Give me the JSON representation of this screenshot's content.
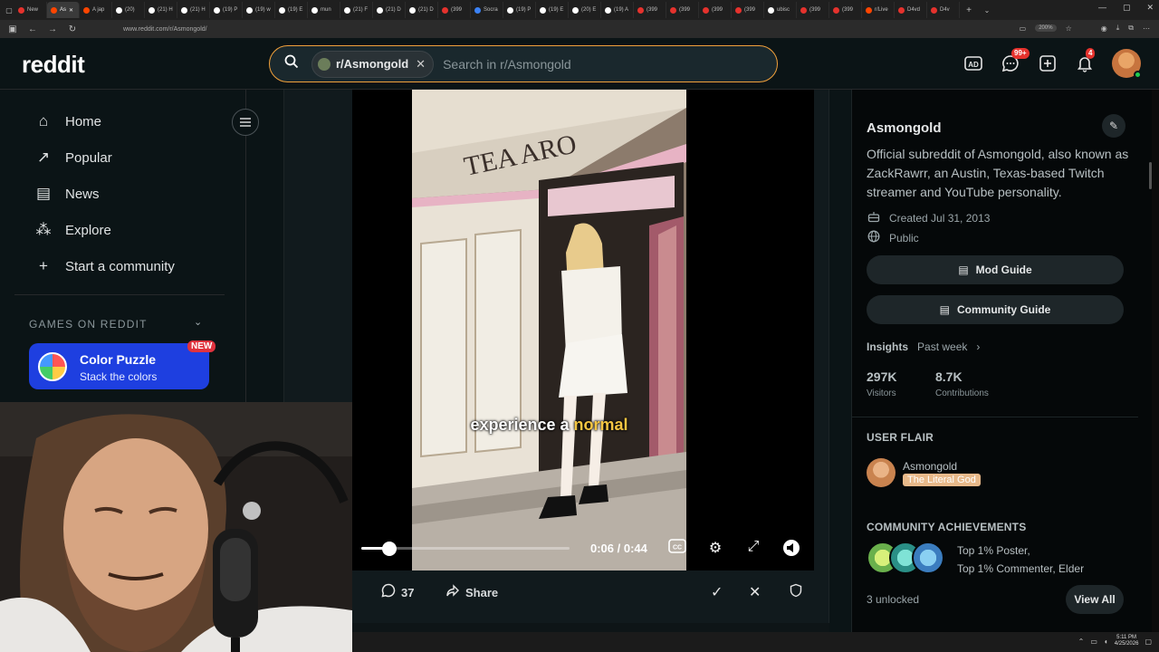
{
  "browser": {
    "tabs": [
      {
        "label": "New",
        "color": "#e5322d"
      },
      {
        "label": "As",
        "color": "#ff4500",
        "active": true
      },
      {
        "label": "A jap",
        "color": "#ff4500"
      },
      {
        "label": "(20)",
        "color": "#ffffff"
      },
      {
        "label": "(21) H",
        "color": "#ffffff"
      },
      {
        "label": "(21) H",
        "color": "#ffffff"
      },
      {
        "label": "(19) P",
        "color": "#ffffff"
      },
      {
        "label": "(19) w",
        "color": "#ffffff"
      },
      {
        "label": "(19) E",
        "color": "#ffffff"
      },
      {
        "label": "mun",
        "color": "#ffffff"
      },
      {
        "label": "(21) F",
        "color": "#ffffff"
      },
      {
        "label": "(21) D",
        "color": "#ffffff"
      },
      {
        "label": "(21) D",
        "color": "#ffffff"
      },
      {
        "label": "(399",
        "color": "#e5322d"
      },
      {
        "label": "Socra",
        "color": "#3b82f6"
      },
      {
        "label": "(19) P",
        "color": "#ffffff"
      },
      {
        "label": "(19) E",
        "color": "#ffffff"
      },
      {
        "label": "(20) E",
        "color": "#ffffff"
      },
      {
        "label": "(19) A",
        "color": "#ffffff"
      },
      {
        "label": "(399",
        "color": "#e5322d"
      },
      {
        "label": "(399",
        "color": "#e5322d"
      },
      {
        "label": "(399",
        "color": "#e5322d"
      },
      {
        "label": "(399",
        "color": "#e5322d"
      },
      {
        "label": "ubisc",
        "color": "#ffffff"
      },
      {
        "label": "(399",
        "color": "#e5322d"
      },
      {
        "label": "(399",
        "color": "#e5322d"
      },
      {
        "label": "r/Live",
        "color": "#ff4500"
      },
      {
        "label": "D4vd",
        "color": "#e5322d"
      },
      {
        "label": "D4v",
        "color": "#e5322d"
      }
    ],
    "url": "www.reddit.com/r/Asmongold/",
    "zoom": "200%"
  },
  "header": {
    "logo": "reddit",
    "search_chip": "r/Asmongold",
    "search_placeholder": "Search in r/Asmongold",
    "chat_badge": "99+",
    "notif_badge": "4"
  },
  "left_nav": {
    "items": [
      {
        "label": "Home",
        "icon": "home-icon",
        "glyph": "⌂"
      },
      {
        "label": "Popular",
        "icon": "popular-icon",
        "glyph": "↗"
      },
      {
        "label": "News",
        "icon": "news-icon",
        "glyph": "▤"
      },
      {
        "label": "Explore",
        "icon": "explore-icon",
        "glyph": "⁂"
      },
      {
        "label": "Start a community",
        "icon": "plus-icon",
        "glyph": "+"
      }
    ],
    "games_heading": "GAMES ON REDDIT",
    "game": {
      "title": "Color Puzzle",
      "subtitle": "Stack the colors",
      "badge": "NEW"
    }
  },
  "video": {
    "caption_plain": "experience a ",
    "caption_highlight": "normal",
    "time": "0:06 / 0:44",
    "progress": 0.136
  },
  "post_actions": {
    "comments": "37",
    "share": "Share"
  },
  "sidebar": {
    "title": "Asmongold",
    "description": "Official subreddit of Asmongold, also known as ZackRawrr, an Austin, Texas-based Twitch streamer and YouTube personality.",
    "created": "Created Jul 31, 2013",
    "visibility": "Public",
    "mod_guide": "Mod Guide",
    "community_guide": "Community Guide",
    "insights_label": "Insights",
    "insights_period": "Past week",
    "visitors_value": "297K",
    "visitors_label": "Visitors",
    "contrib_value": "8.7K",
    "contrib_label": "Contributions",
    "user_flair_heading": "USER FLAIR",
    "flair_user": "Asmongold",
    "flair_text": "The Literal God",
    "achievements_heading": "COMMUNITY ACHIEVEMENTS",
    "achievement_1": "Top 1% Poster,",
    "achievement_2": "Top 1% Commenter, Elder",
    "unlocked": "3 unlocked",
    "view_all": "View All"
  },
  "taskbar": {
    "time": "5:11 PM",
    "date": "4/25/2026"
  }
}
